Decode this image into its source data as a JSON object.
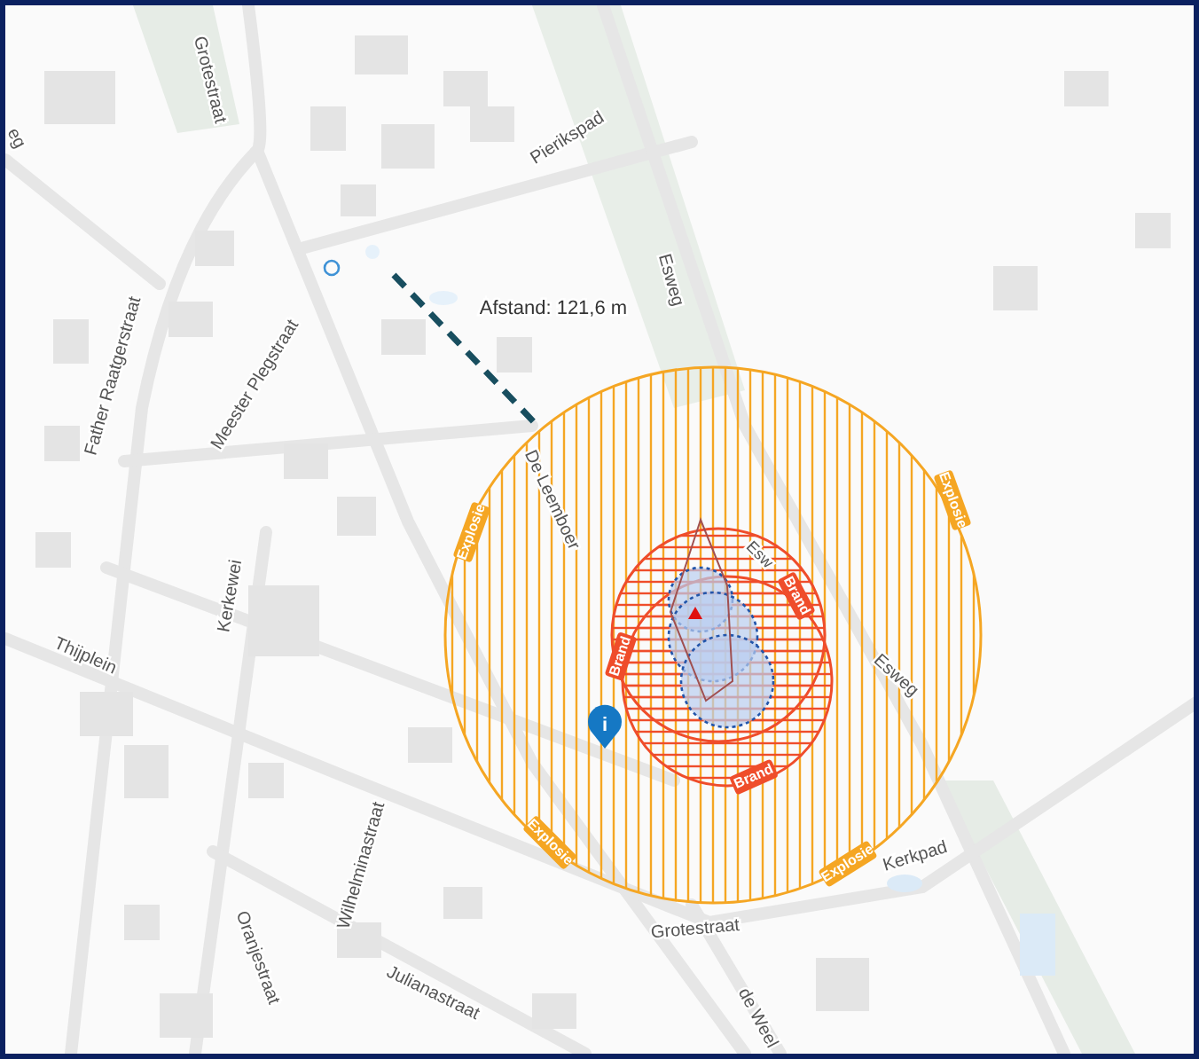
{
  "map": {
    "distance_label": "Afstand: 121,6 m",
    "street_labels": [
      {
        "text": "Grotestraat"
      },
      {
        "text": "Pierikspad"
      },
      {
        "text": "Esweg"
      },
      {
        "text": "Father Raatgerstraat"
      },
      {
        "text": "Meester Plegstraat"
      },
      {
        "text": "De Leemboer"
      },
      {
        "text": "Kerkewei"
      },
      {
        "text": "Thijplein"
      },
      {
        "text": "Wilhelminastraat"
      },
      {
        "text": "Julianastraat"
      },
      {
        "text": "Oranjestraat"
      },
      {
        "text": "Grotestraat"
      },
      {
        "text": "de Weel"
      },
      {
        "text": "Kerkpad"
      },
      {
        "text": "Esweg"
      },
      {
        "text": "Esw"
      },
      {
        "text": "eg"
      }
    ],
    "zone_labels": [
      {
        "text": "Explosie",
        "kind": "explosion"
      },
      {
        "text": "Explosie",
        "kind": "explosion"
      },
      {
        "text": "Explosie",
        "kind": "explosion"
      },
      {
        "text": "Explosie",
        "kind": "explosion"
      },
      {
        "text": "Brand",
        "kind": "fire"
      },
      {
        "text": "Brand",
        "kind": "fire"
      },
      {
        "text": "Brand",
        "kind": "fire"
      }
    ],
    "marker": {
      "text": "i"
    }
  }
}
